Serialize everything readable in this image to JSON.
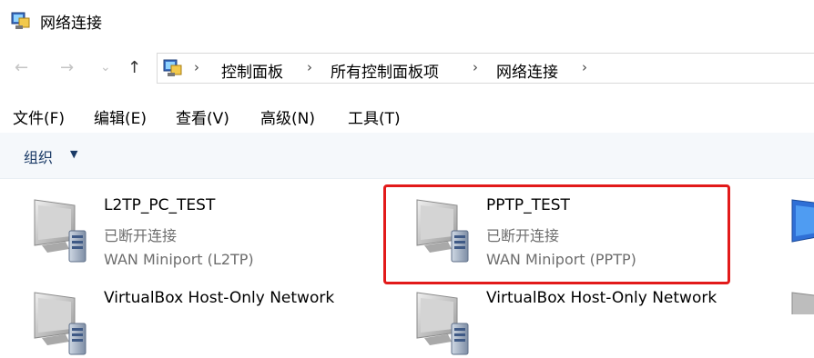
{
  "window": {
    "title": "网络连接"
  },
  "address": {
    "crumbs": [
      "控制面板",
      "所有控制面板项",
      "网络连接"
    ]
  },
  "nav": {
    "back": "←",
    "forward": "→",
    "recent": "⌄",
    "up": "↑"
  },
  "menus": [
    "文件(F)",
    "编辑(E)",
    "查看(V)",
    "高级(N)",
    "工具(T)"
  ],
  "toolbar": {
    "organize": "组织",
    "organize_arrow": "▼"
  },
  "connections": [
    {
      "name": "L2TP_PC_TEST",
      "status": "已断开连接",
      "device": "WAN Miniport (L2TP)"
    },
    {
      "name": "PPTP_TEST",
      "status": "已断开连接",
      "device": "WAN Miniport (PPTP)"
    },
    {
      "name": "VirtualBox Host-Only Network",
      "status": "",
      "device": ""
    },
    {
      "name": "VirtualBox Host-Only Network",
      "status": "",
      "device": ""
    }
  ],
  "colors": {
    "highlight": "#e21a1a",
    "toolbar_bg": "#f5f8fb",
    "secondary_text": "#6d6d6d"
  }
}
